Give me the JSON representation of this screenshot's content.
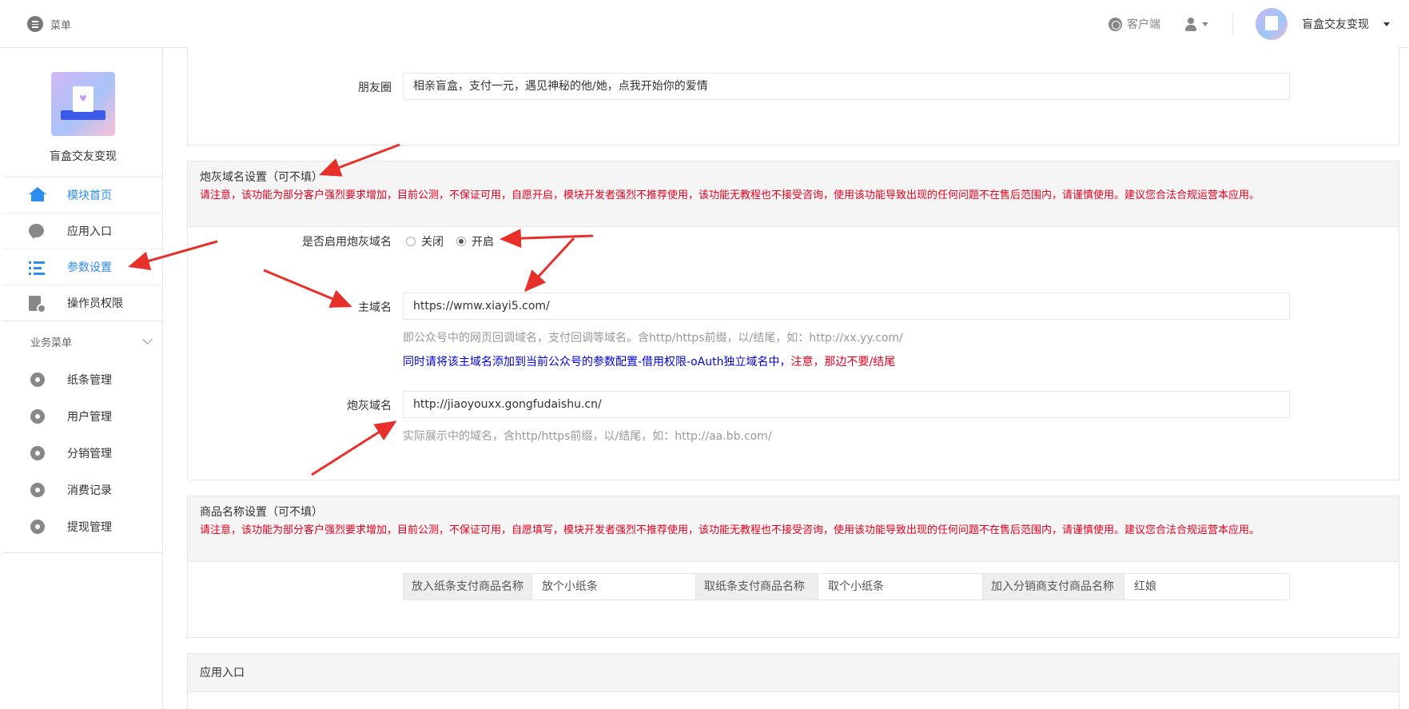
{
  "topbar": {
    "menu_label": "菜单",
    "client_label": "客户端",
    "account_name": "盲盒交友变现"
  },
  "sidebar": {
    "profile_name": "盲盒交友变现",
    "items": [
      {
        "label": "模块首页",
        "icon": "home-icon",
        "active": false
      },
      {
        "label": "应用入口",
        "icon": "chat-icon",
        "active": false
      },
      {
        "label": "参数设置",
        "icon": "list-icon",
        "active": true
      },
      {
        "label": "操作员权限",
        "icon": "document-icon",
        "active": false
      }
    ],
    "group_title": "业务菜单",
    "group_items": [
      {
        "label": "纸条管理",
        "icon": "gear-icon"
      },
      {
        "label": "用户管理",
        "icon": "gear-icon"
      },
      {
        "label": "分销管理",
        "icon": "gear-icon"
      },
      {
        "label": "消费记录",
        "icon": "gear-icon"
      },
      {
        "label": "提现管理",
        "icon": "gear-icon"
      }
    ]
  },
  "share": {
    "label": "朋友圈",
    "value": "相亲盲盒，支付一元，遇见神秘的他/她，点我开始你的爱情"
  },
  "domain_section": {
    "title": "炮灰域名设置（可不填）",
    "warning": "请注意，该功能为部分客户强烈要求增加，目前公测，不保证可用，自愿开启，模块开发者强烈不推荐使用，该功能无教程也不接受咨询，使用该功能导致出现的任何问题不在售后范围内，请谨慎使用。建议您合法合规运营本应用。",
    "enable_label": "是否启用炮灰域名",
    "option_off": "关闭",
    "option_on": "开启",
    "selected": "开启",
    "main_label": "主域名",
    "main_value": "https://wmw.xiayi5.com/",
    "main_help": "即公众号中的网页回调域名，支付回调等域名。含http/https前缀，以/结尾，如：http://xx.yy.com/",
    "main_help2_blue": "同时请将该主域名添加到当前公众号的参数配置-借用权限-oAuth独立域名中，",
    "main_help2_red": "注意，那边不要/结尾",
    "cannon_label": "炮灰域名",
    "cannon_value": "http://jiaoyouxx.gongfudaishu.cn/",
    "cannon_help": "实际展示中的域名，含http/https前缀，以/结尾，如：http://aa.bb.com/"
  },
  "product_section": {
    "title": "商品名称设置（可不填）",
    "warning": "请注意，该功能为部分客户强烈要求增加，目前公测，不保证可用，自愿填写，模块开发者强烈不推荐使用，该功能无教程也不接受咨询，使用该功能导致出现的任何问题不在售后范围内，请谨慎使用。建议您合法合规运营本应用。",
    "put_label": "放入纸条支付商品名称",
    "put_value": "放个小纸条",
    "take_label": "取纸条支付商品名称",
    "take_value": "取个小纸条",
    "dist_label": "加入分销商支付商品名称",
    "dist_value": "红娘"
  },
  "entry_section": {
    "title": "应用入口"
  },
  "colors": {
    "accent": "#2d8cf0",
    "warning": "#e6001e",
    "annotation_arrow": "#e8302a"
  }
}
